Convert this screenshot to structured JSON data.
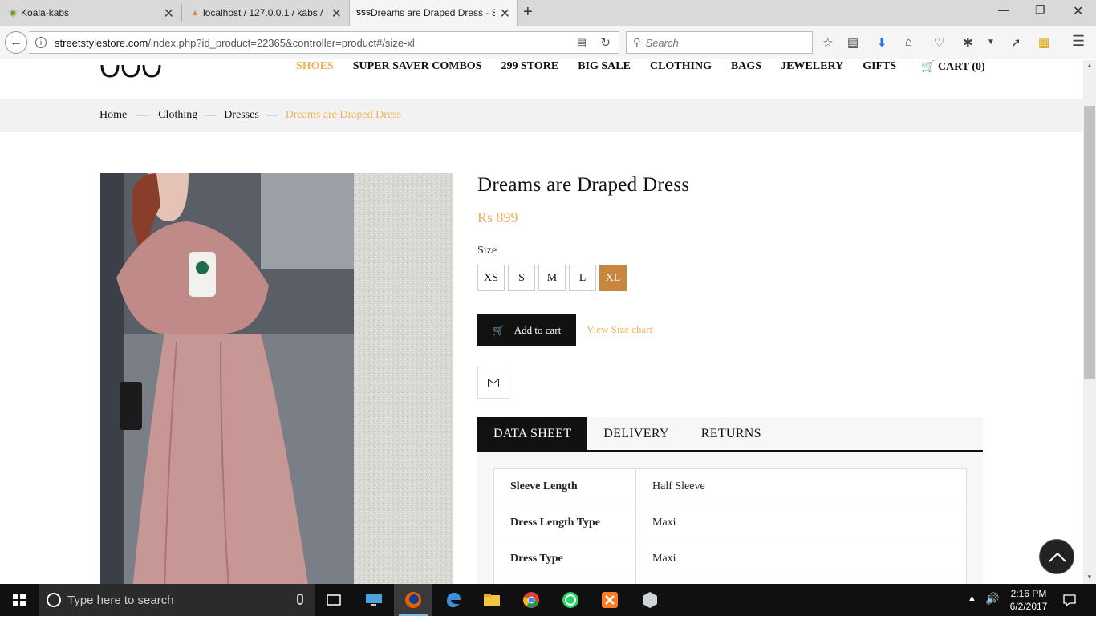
{
  "browser": {
    "tabs": [
      {
        "title": "Koala-kabs",
        "icon": "koala-favicon"
      },
      {
        "title": "localhost / 127.0.0.1 / kabs /",
        "icon": "phpmyadmin-favicon"
      },
      {
        "title": "Dreams are Draped Dress - S",
        "icon": "sss-favicon"
      }
    ],
    "url_host": "streetstylestore.com",
    "url_path": "/index.php?id_product=22365&controller=product#/size-xl",
    "search_placeholder": "Search"
  },
  "site": {
    "logo": "SSS",
    "menu": [
      "SHOES",
      "SUPER SAVER COMBOS",
      "299 STORE",
      "BIG SALE",
      "CLOTHING",
      "BAGS",
      "JEWELERY",
      "GIFTS"
    ],
    "active_menu": "SHOES",
    "cart_label": "CART (0)",
    "accent_color": "#f0b35a"
  },
  "breadcrumb": {
    "home": "Home",
    "sep": "—",
    "level1": "Clothing",
    "level2": "Dresses",
    "current": "Dreams are Draped Dress"
  },
  "product": {
    "title": "Dreams are Draped Dress",
    "price": "Rs 899",
    "size_label": "Size",
    "sizes": [
      "XS",
      "S",
      "M",
      "L",
      "XL"
    ],
    "selected_size": "XL",
    "add_to_cart": "Add to cart",
    "size_chart_link": "View Size chart"
  },
  "tabs": [
    "DATA SHEET",
    "DELIVERY",
    "RETURNS"
  ],
  "active_tab": "DATA SHEET",
  "data_sheet": [
    {
      "key": "Sleeve Length",
      "value": "Half Sleeve"
    },
    {
      "key": "Dress Length Type",
      "value": "Maxi"
    },
    {
      "key": "Dress Type",
      "value": "Maxi"
    }
  ],
  "taskbar": {
    "search_placeholder": "Type here to search",
    "time": "2:16 PM",
    "date": "6/2/2017"
  }
}
